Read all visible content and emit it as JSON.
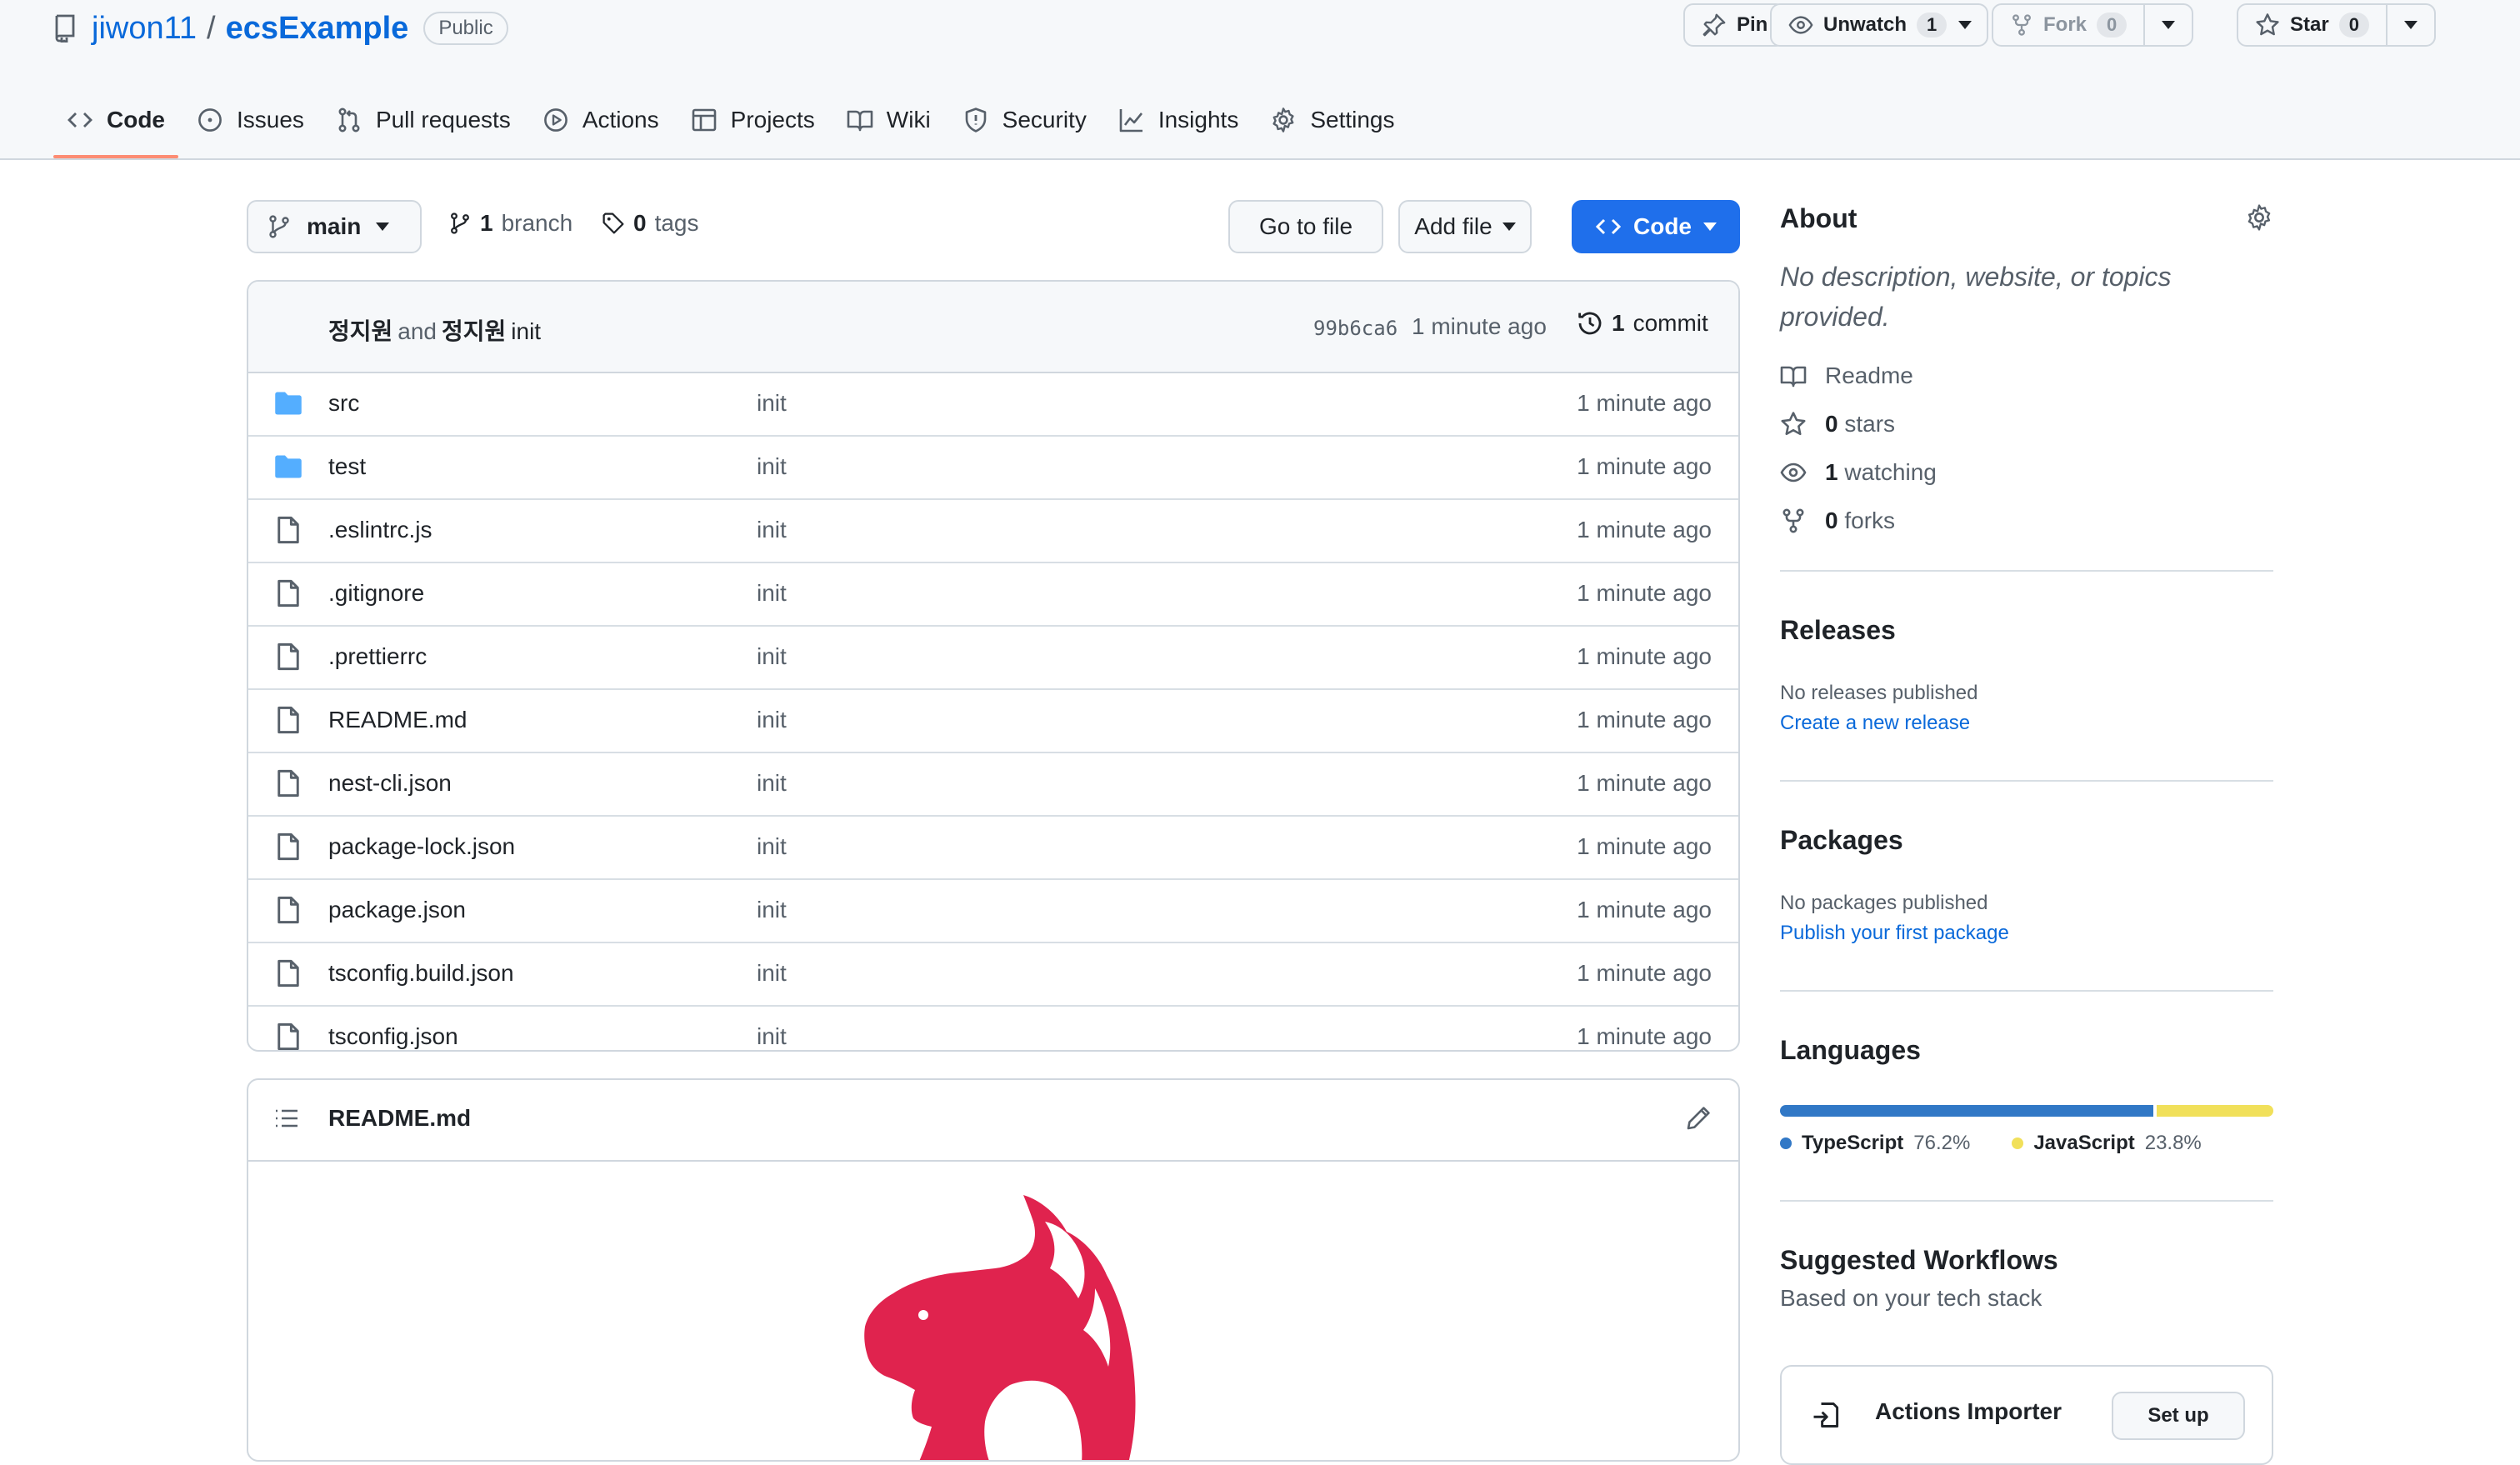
{
  "repo": {
    "owner": "jiwon11",
    "separator": "/",
    "name": "ecsExample",
    "visibility": "Public"
  },
  "header_actions": {
    "pin": {
      "label": "Pin"
    },
    "unwatch": {
      "label": "Unwatch",
      "count": "1"
    },
    "fork": {
      "label": "Fork",
      "count": "0"
    },
    "star": {
      "label": "Star",
      "count": "0"
    }
  },
  "tabs": [
    {
      "label": "Code",
      "icon": "code-icon",
      "selected": true
    },
    {
      "label": "Issues",
      "icon": "issue-icon"
    },
    {
      "label": "Pull requests",
      "icon": "pull-request-icon"
    },
    {
      "label": "Actions",
      "icon": "play-icon"
    },
    {
      "label": "Projects",
      "icon": "table-icon"
    },
    {
      "label": "Wiki",
      "icon": "book-icon"
    },
    {
      "label": "Security",
      "icon": "shield-icon"
    },
    {
      "label": "Insights",
      "icon": "graph-icon"
    },
    {
      "label": "Settings",
      "icon": "gear-icon"
    }
  ],
  "toolbar": {
    "branch": "main",
    "branch_count": "1",
    "branch_label": "branch",
    "tag_count": "0",
    "tag_label": "tags",
    "go_to_file": "Go to file",
    "add_file": "Add file",
    "code": "Code"
  },
  "latest_commit": {
    "author1": "정지원",
    "and": "and",
    "author2": "정지원",
    "message": "init",
    "sha": "99b6ca6",
    "time": "1 minute ago",
    "count": "1",
    "count_label": "commit"
  },
  "files": [
    {
      "name": "src",
      "type": "dir",
      "message": "init",
      "age": "1 minute ago"
    },
    {
      "name": "test",
      "type": "dir",
      "message": "init",
      "age": "1 minute ago"
    },
    {
      "name": ".eslintrc.js",
      "type": "file",
      "message": "init",
      "age": "1 minute ago"
    },
    {
      "name": ".gitignore",
      "type": "file",
      "message": "init",
      "age": "1 minute ago"
    },
    {
      "name": ".prettierrc",
      "type": "file",
      "message": "init",
      "age": "1 minute ago"
    },
    {
      "name": "README.md",
      "type": "file",
      "message": "init",
      "age": "1 minute ago"
    },
    {
      "name": "nest-cli.json",
      "type": "file",
      "message": "init",
      "age": "1 minute ago"
    },
    {
      "name": "package-lock.json",
      "type": "file",
      "message": "init",
      "age": "1 minute ago"
    },
    {
      "name": "package.json",
      "type": "file",
      "message": "init",
      "age": "1 minute ago"
    },
    {
      "name": "tsconfig.build.json",
      "type": "file",
      "message": "init",
      "age": "1 minute ago"
    },
    {
      "name": "tsconfig.json",
      "type": "file",
      "message": "init",
      "age": "1 minute ago"
    }
  ],
  "readme": {
    "title": "README.md",
    "logo": "nestjs-logo",
    "logo_color": "#e0234e"
  },
  "about": {
    "title": "About",
    "description": "No description, website, or topics provided.",
    "readme": "Readme",
    "stars_count": "0",
    "stars_label": "stars",
    "watching_count": "1",
    "watching_label": "watching",
    "forks_count": "0",
    "forks_label": "forks"
  },
  "releases": {
    "title": "Releases",
    "empty": "No releases published",
    "link": "Create a new release"
  },
  "packages": {
    "title": "Packages",
    "empty": "No packages published",
    "link": "Publish your first package"
  },
  "languages": {
    "title": "Languages",
    "items": [
      {
        "name": "TypeScript",
        "percent": "76.2%",
        "share": 76.2,
        "color": "#3178c6"
      },
      {
        "name": "JavaScript",
        "percent": "23.8%",
        "share": 23.8,
        "color": "#f1e05a"
      }
    ]
  },
  "workflows": {
    "title": "Suggested Workflows",
    "subtitle": "Based on your tech stack",
    "card_title": "Actions Importer",
    "card_button": "Set up"
  },
  "colors": {
    "accent": "#0969da",
    "primary_button": "#1f6feb",
    "tab_underline": "#fd8c73",
    "folder": "#54aeff"
  }
}
